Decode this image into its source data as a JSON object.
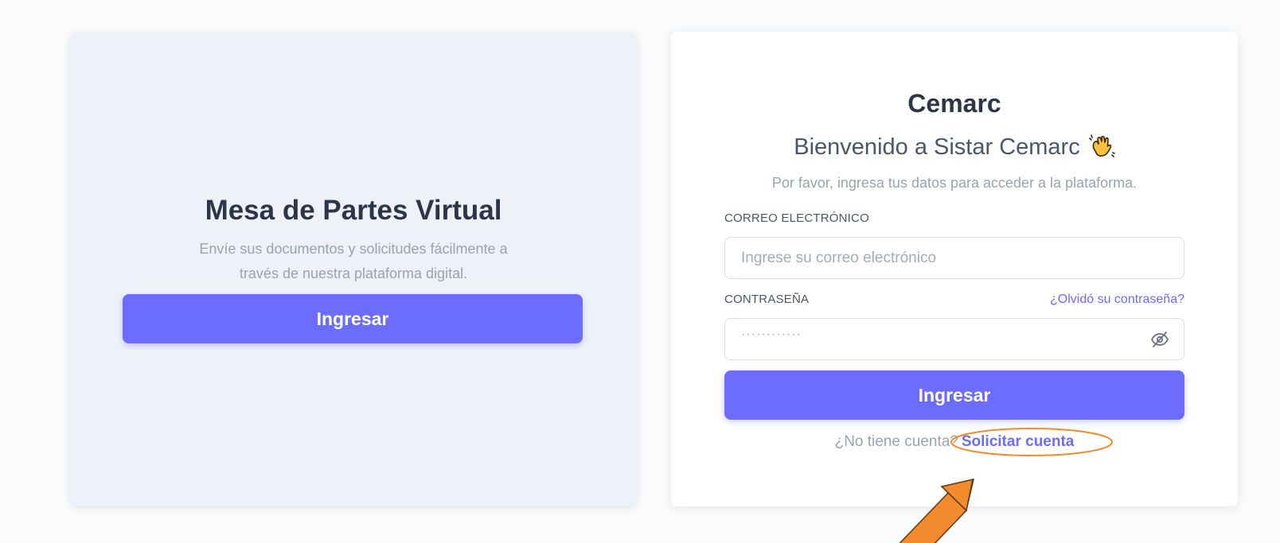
{
  "left_panel": {
    "title": "Mesa de Partes Virtual",
    "description": "Envíe sus documentos y solicitudes fácilmente a través de nuestra plataforma digital.",
    "button_label": "Ingresar"
  },
  "login": {
    "brand": "Cemarc",
    "welcome": "Bienvenido a Sistar Cemarc",
    "welcome_icon": "waving-hand-icon",
    "subtitle": "Por favor, ingresa tus datos para acceder a la plataforma.",
    "email_label": "CORREO ELECTRÓNICO",
    "email_placeholder": "Ingrese su correo electrónico",
    "password_label": "CONTRASEÑA",
    "forgot_link": "¿Olvidó su contraseña?",
    "password_mask": "············",
    "password_toggle_icon": "eye-off-icon",
    "submit_label": "Ingresar",
    "no_account_text": "¿No tiene cuenta?",
    "signup_link": "Solicitar cuenta"
  },
  "colors": {
    "accent": "#6c6cff",
    "heading": "#2d3648",
    "muted": "#9aa3b1",
    "left_panel_bg": "#eef2f8",
    "annotation": "#f28a2e"
  }
}
